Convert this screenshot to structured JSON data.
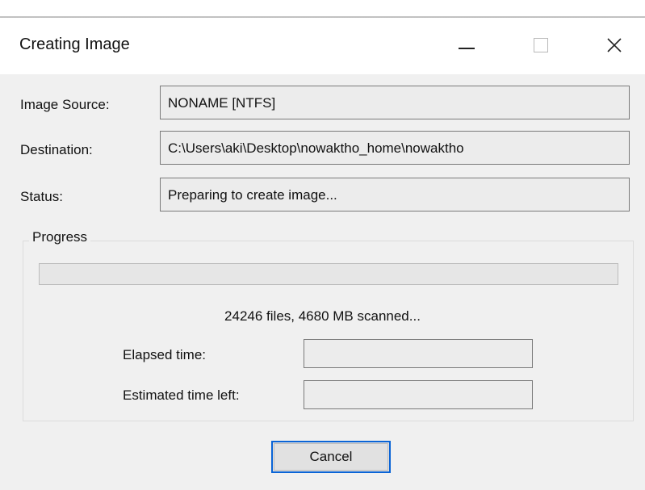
{
  "window": {
    "title": "Creating Image"
  },
  "fields": {
    "image_source": {
      "label": "Image Source:",
      "value": "NONAME [NTFS]"
    },
    "destination": {
      "label": "Destination:",
      "value": "C:\\Users\\aki\\Desktop\\nowaktho_home\\nowaktho"
    },
    "status": {
      "label": "Status:",
      "value": "Preparing to create image..."
    }
  },
  "progress": {
    "group_label": "Progress",
    "percent": 0,
    "scan_text": "24246 files, 4680 MB scanned...",
    "elapsed_label": "Elapsed time:",
    "elapsed_value": "",
    "remaining_label": "Estimated time left:",
    "remaining_value": ""
  },
  "buttons": {
    "cancel": "Cancel"
  },
  "colors": {
    "accent_border": "#0a64d6",
    "progress_fill": "#06b025"
  },
  "icons": {
    "minimize": "minimize-icon",
    "maximize": "maximize-icon",
    "close": "close-icon"
  }
}
